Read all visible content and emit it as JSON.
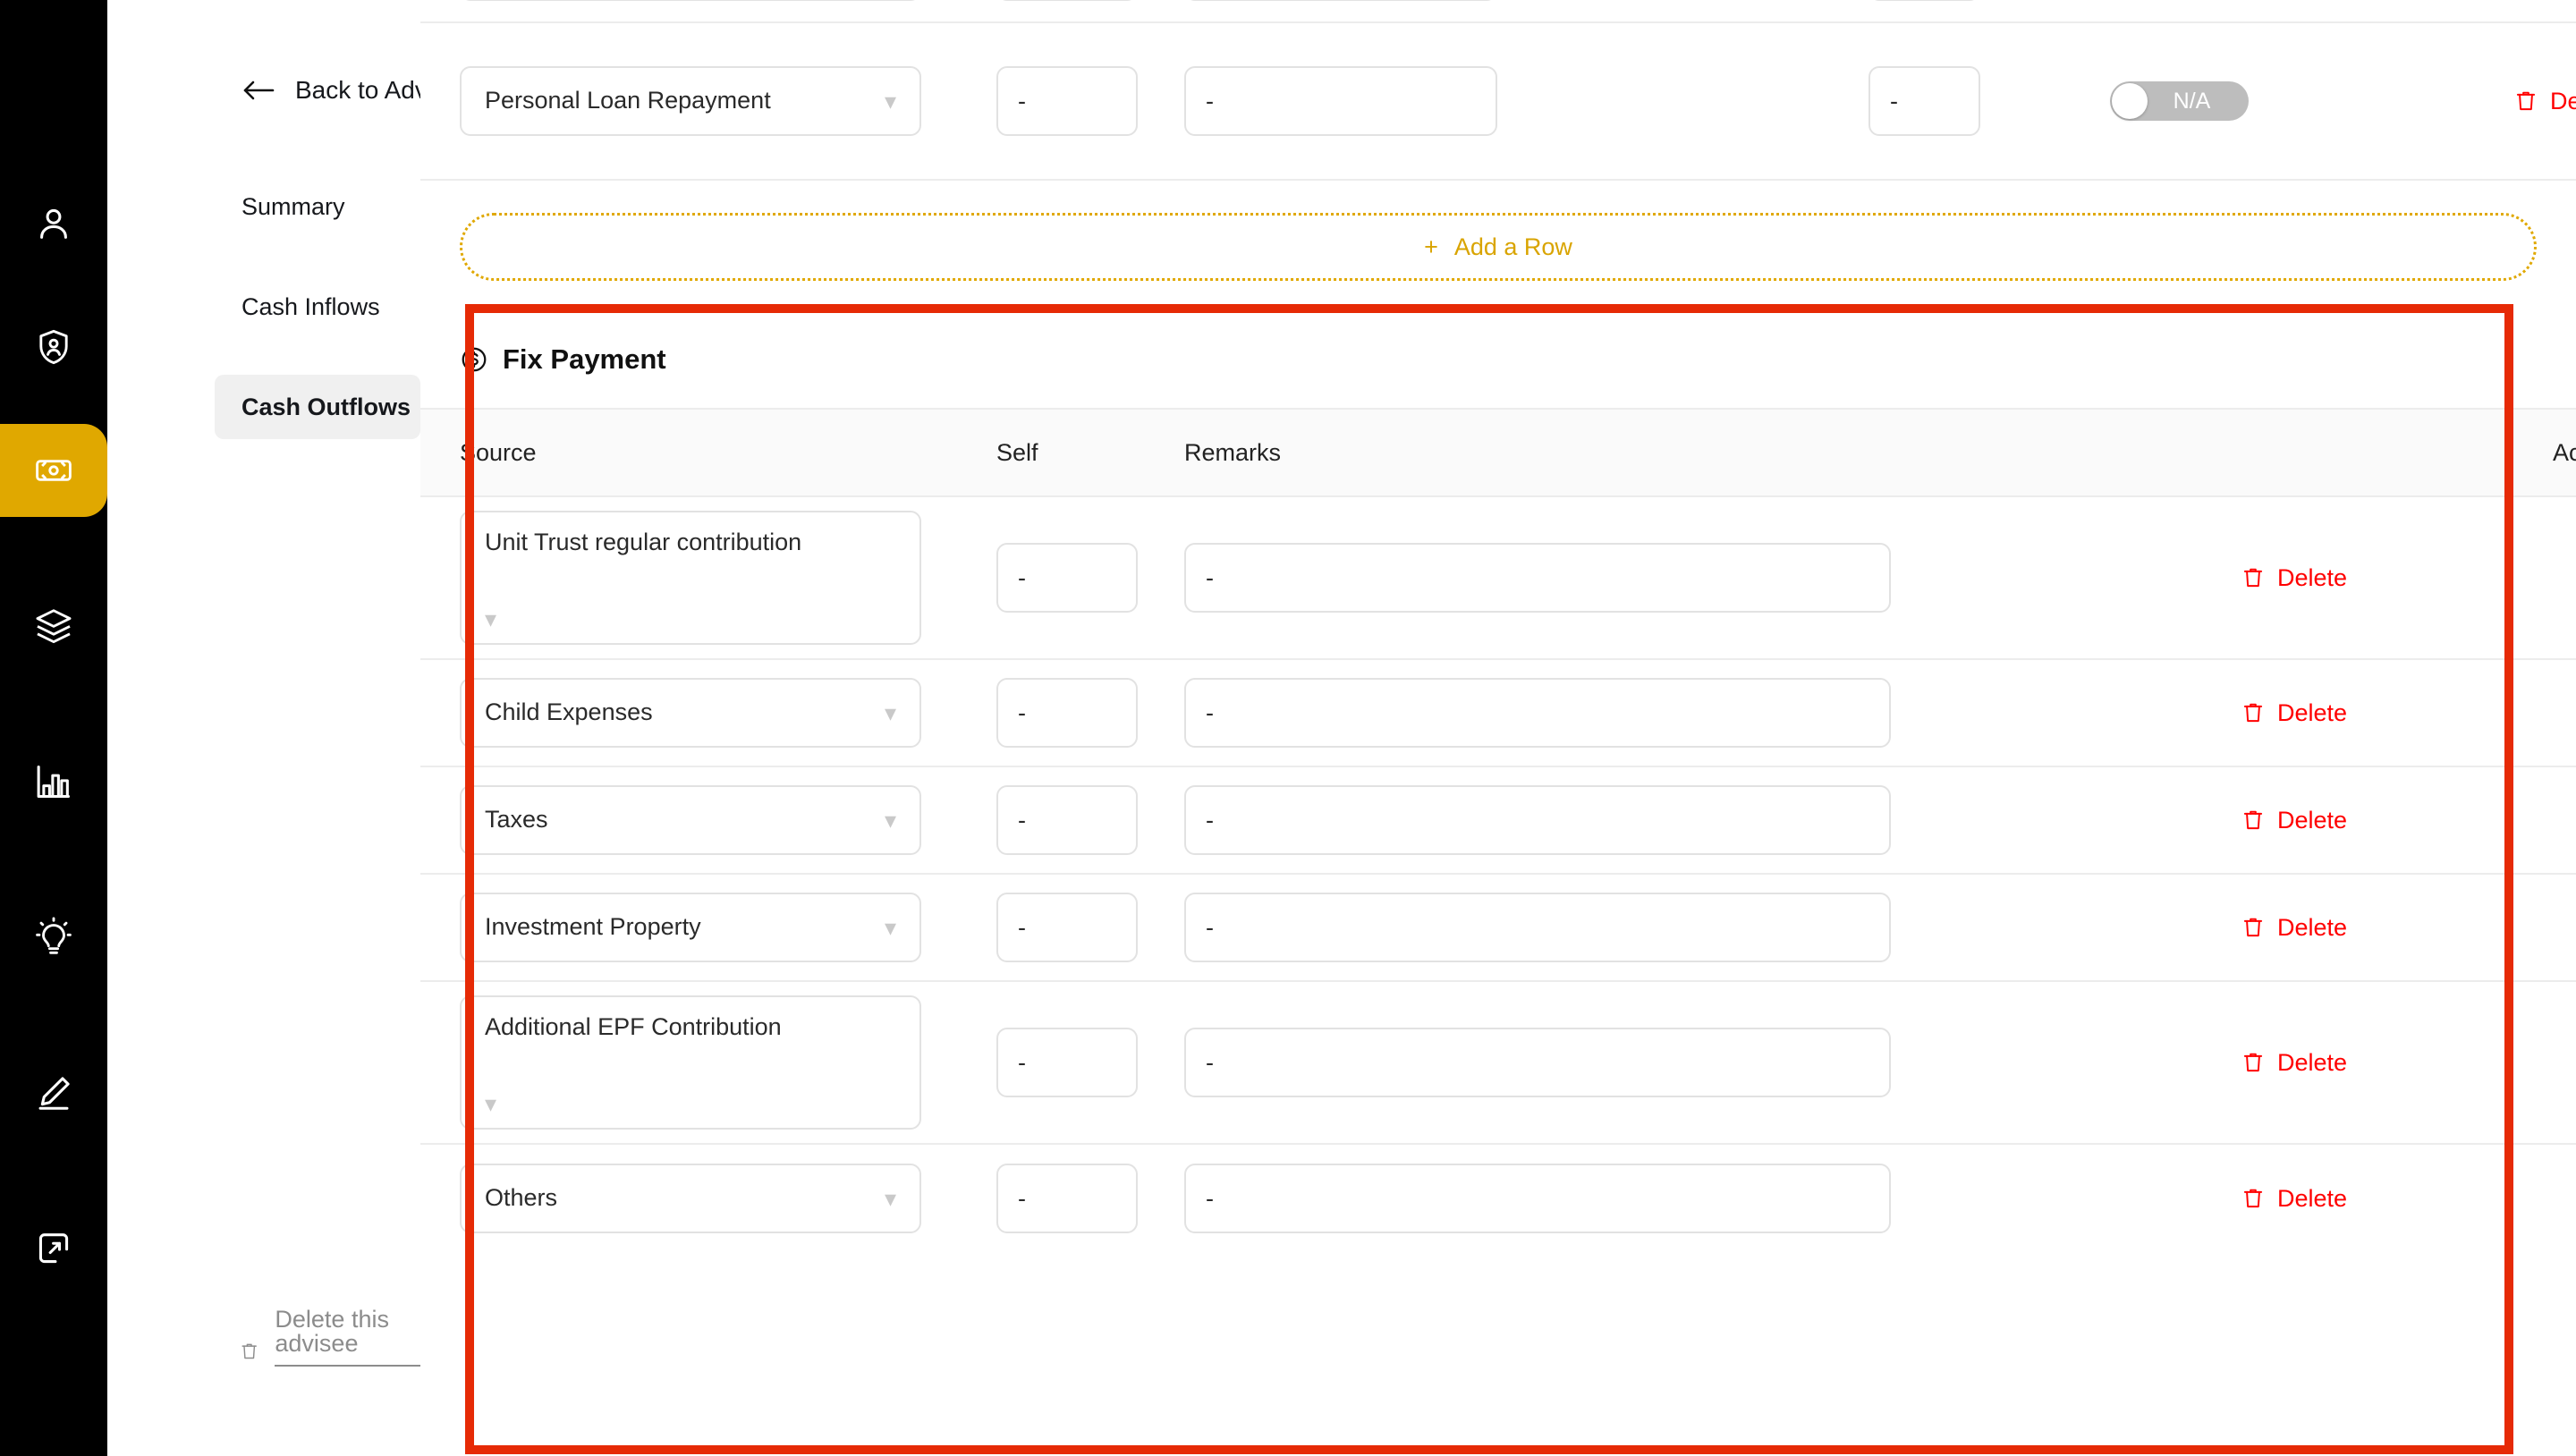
{
  "rail": {
    "items": [
      {
        "icon": "user-icon",
        "active": false
      },
      {
        "icon": "shield-user-icon",
        "active": false
      },
      {
        "icon": "cash-banknote-icon",
        "active": true
      },
      {
        "icon": "layers-icon",
        "active": false
      },
      {
        "icon": "bar-chart-icon",
        "active": false
      },
      {
        "icon": "lightbulb-icon",
        "active": false
      },
      {
        "icon": "pencil-edit-icon",
        "active": false
      },
      {
        "icon": "logout-icon",
        "active": false
      }
    ]
  },
  "subnav": {
    "back_label": "Back to Advisees",
    "items": [
      {
        "label": "Summary",
        "selected": false
      },
      {
        "label": "Cash Inflows",
        "selected": false
      },
      {
        "label": "Cash Outflows",
        "selected": true
      }
    ],
    "delete_advisee_label": "Delete this advisee"
  },
  "top_table": {
    "add_row_label": "Add a Row",
    "add_row_plus": "+",
    "rows": [
      {
        "source": "Personal Loan Repayment",
        "chevron": "⌄",
        "v1": "-",
        "v2": "-",
        "v3": "-",
        "toggle_label": "N/A",
        "delete_label": "Delete"
      }
    ]
  },
  "fix_payment": {
    "icon": "dollar-circle-icon",
    "title": "Fix Payment",
    "columns": [
      "Source",
      "Self",
      "Remarks",
      "Action"
    ],
    "chevron": "⌄",
    "rows": [
      {
        "source": "Unit Trust regular contribution",
        "wrapped": true,
        "self": "-",
        "remarks": "-",
        "delete_label": "Delete"
      },
      {
        "source": "Child Expenses",
        "wrapped": false,
        "self": "-",
        "remarks": "-",
        "delete_label": "Delete"
      },
      {
        "source": "Taxes",
        "wrapped": false,
        "self": "-",
        "remarks": "-",
        "delete_label": "Delete"
      },
      {
        "source": "Investment Property",
        "wrapped": false,
        "self": "-",
        "remarks": "-",
        "delete_label": "Delete"
      },
      {
        "source": "Additional EPF Contribution",
        "wrapped": true,
        "self": "-",
        "remarks": "-",
        "delete_label": "Delete"
      },
      {
        "source": "Others",
        "wrapped": false,
        "self": "-",
        "remarks": "-",
        "delete_label": "Delete"
      }
    ]
  },
  "colors": {
    "accent_gold": "#e0a800",
    "danger_red": "#ff0000",
    "annotation_red": "#e62a06",
    "rail_bg": "#000000",
    "selected_nav_bg": "#f0f0f0"
  }
}
